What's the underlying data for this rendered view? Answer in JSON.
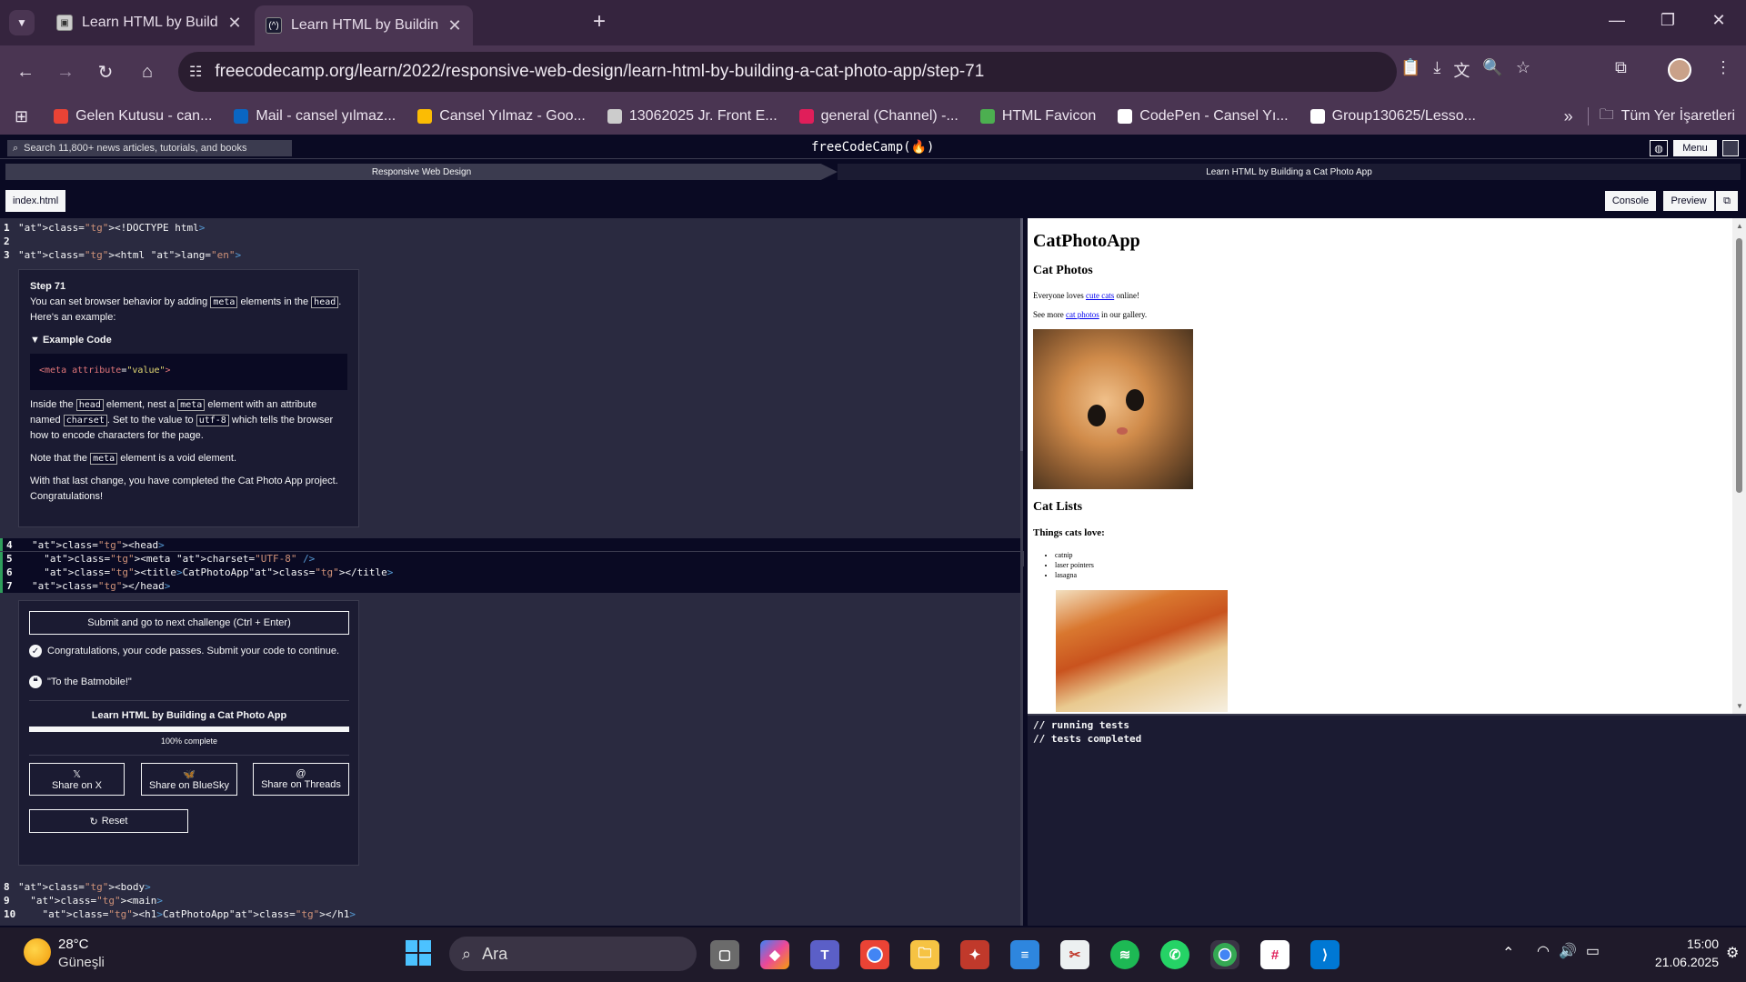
{
  "browser": {
    "tabs": [
      {
        "title": "Learn HTML by Building a Cat P",
        "active": false
      },
      {
        "title": "Learn HTML by Building a Cat P",
        "active": true
      }
    ],
    "new_tab": "+",
    "url": "freecodecamp.org/learn/2022/responsive-web-design/learn-html-by-building-a-cat-photo-app/step-71",
    "bookmarks": [
      {
        "label": "Gelen Kutusu - can...",
        "color": "#ea4335"
      },
      {
        "label": "Mail - cansel yılmaz...",
        "color": "#0a66c2"
      },
      {
        "label": "Cansel Yılmaz - Goo...",
        "color": "#fbbc04"
      },
      {
        "label": "13062025 Jr. Front E...",
        "color": "#cccccc"
      },
      {
        "label": "general (Channel) -...",
        "color": "#e01e5a"
      },
      {
        "label": "HTML Favicon",
        "color": "#4caf50"
      },
      {
        "label": "CodePen - Cansel Yı...",
        "color": "#ffffff"
      },
      {
        "label": "Group130625/Lesso...",
        "color": "#ffffff"
      }
    ],
    "bookmarks_more": "»",
    "all_bookmarks": "Tüm Yer İşaretleri"
  },
  "fcc": {
    "search_placeholder": "Search 11,800+ news articles, tutorials, and books",
    "logo": "freeCodeCamp(🔥)",
    "menu": "Menu",
    "breadcrumb": [
      "Responsive Web Design",
      "Learn HTML by Building a Cat Photo App"
    ],
    "file_tab": "index.html",
    "console_btn": "Console",
    "preview_btn": "Preview"
  },
  "step": {
    "title": "Step 71",
    "p1a": "You can set browser behavior by adding",
    "code_meta": "meta",
    "p1b": "elements in the",
    "code_head": "head",
    "p1c": ".",
    "p1d": "Here's an example:",
    "example_label": "Example Code",
    "example_code_tag": "<meta",
    "example_code_attr": " attribute",
    "example_code_eq": "=",
    "example_code_val": "\"value\"",
    "example_code_end": ">",
    "p2a": "Inside the",
    "p2b": "element, nest a",
    "p2c": "element with an attribute",
    "p2d": "named",
    "code_charset": "charset",
    "p2e": ". Set to the value to",
    "code_utf8": "utf-8",
    "p2f": "which tells the browser",
    "p2g": "how to encode characters for the page.",
    "p3a": "Note that the",
    "p3b": "element is a void element.",
    "p4": "With that last change, you have completed the Cat Photo App project. Congratulations!"
  },
  "editor": {
    "lines_top": [
      {
        "n": "1",
        "html": "<!DOCTYPE html>"
      },
      {
        "n": "2",
        "html": ""
      },
      {
        "n": "3",
        "html": "<html lang=\"en\">"
      }
    ],
    "lines_mid": [
      {
        "n": "4",
        "html": "<head>"
      },
      {
        "n": "5",
        "html": "  <meta charset=\"UTF-8\" />"
      },
      {
        "n": "6",
        "html": "  <title>CatPhotoApp</title>"
      },
      {
        "n": "7",
        "html": "</head>"
      }
    ],
    "lines_bottom": [
      {
        "n": "8",
        "html": "<body>"
      },
      {
        "n": "9",
        "html": "  <main>"
      },
      {
        "n": "10",
        "html": "    <h1>CatPhotoApp</h1>"
      }
    ]
  },
  "result": {
    "submit": "Submit and go to next challenge (Ctrl + Enter)",
    "pass_msg": "Congratulations, your code passes. Submit your code to continue.",
    "quote": "\"To the Batmobile!\"",
    "cert_title": "Learn HTML by Building a Cat Photo App",
    "progress_percent": 100,
    "progress_label": "100% complete",
    "share_x": "Share on X",
    "share_bluesky": "Share on BlueSky",
    "share_threads": "Share on Threads",
    "reset": "Reset"
  },
  "preview": {
    "h1": "CatPhotoApp",
    "h2a": "Cat Photos",
    "p1a": "Everyone loves ",
    "p1link": "cute cats",
    "p1b": " online!",
    "p2a": "See more ",
    "p2link": "cat photos",
    "p2b": " in our gallery.",
    "h2b": "Cat Lists",
    "h3": "Things cats love:",
    "list": [
      "catnip",
      "laser pointers",
      "lasagna"
    ]
  },
  "console": {
    "lines": [
      "// running tests",
      "// tests completed"
    ]
  },
  "taskbar": {
    "weather_temp": "28°C",
    "weather_desc": "Güneşli",
    "search_placeholder": "Ara",
    "time": "15:00",
    "date": "21.06.2025"
  }
}
